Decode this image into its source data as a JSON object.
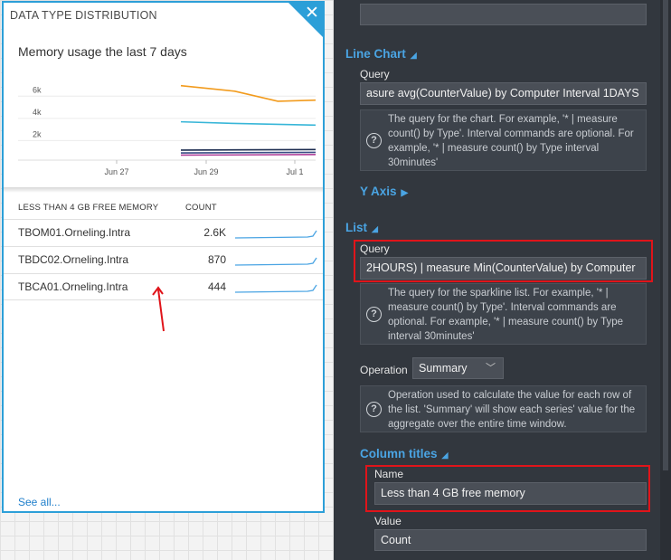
{
  "tile": {
    "title": "DATA TYPE DISTRIBUTION",
    "close_icon": "close-icon",
    "chart_title": "Memory usage the last 7 days",
    "list_header": {
      "name": "LESS THAN 4 GB FREE MEMORY",
      "count": "COUNT"
    },
    "rows": [
      {
        "name": "TBOM01.Orneling.Intra",
        "count": "2.6K"
      },
      {
        "name": "TBDC02.Orneling.Intra",
        "count": "870"
      },
      {
        "name": "TBCA01.Orneling.Intra",
        "count": "444"
      }
    ],
    "see_all": "See all...",
    "accent_color": "#2c9fd8"
  },
  "chart_data": {
    "type": "line",
    "x_ticks": [
      "Jun 27",
      "Jun 29",
      "Jul 1"
    ],
    "y_ticks": [
      "2k",
      "4k",
      "6k"
    ],
    "ylim": [
      0,
      7000
    ],
    "series": [
      {
        "color": "#f29b1d",
        "x": [
          0,
          0.4,
          0.72,
          1.0
        ],
        "values": [
          6700,
          6200,
          5300,
          5400
        ]
      },
      {
        "color": "#38b6d8",
        "x": [
          0,
          0.4,
          1.0
        ],
        "values": [
          3450,
          3300,
          3150
        ]
      },
      {
        "color": "#1b2b4f",
        "x": [
          0,
          1.0
        ],
        "values": [
          900,
          950
        ]
      },
      {
        "color": "#3b4f86",
        "x": [
          0,
          1.0
        ],
        "values": [
          650,
          700
        ]
      },
      {
        "color": "#b0419a",
        "x": [
          0,
          1.0
        ],
        "values": [
          450,
          500
        ]
      }
    ],
    "x_range": [
      -1.02,
      1.1
    ]
  },
  "panel": {
    "line_chart": {
      "section": "Line Chart",
      "query_label": "Query",
      "query_value": "asure avg(CounterValue) by Computer Interval 1DAYS",
      "help": "The query for the chart. For example, '* | measure count() by Type'. Interval commands are optional. For example, '* | measure count() by Type interval 30minutes'"
    },
    "y_axis": {
      "section": "Y Axis"
    },
    "list": {
      "section": "List",
      "query_label": "Query",
      "query_value": "2HOURS) | measure Min(CounterValue) by Computer",
      "help": "The query for the sparkline list. For example, '* | measure count() by Type'. Interval commands are optional. For example, '* | measure count() by Type interval 30minutes'",
      "operation_label": "Operation",
      "operation_value": "Summary",
      "operation_help": "Operation used to calculate the value for each row of the list. 'Summary' will show each series' value for the aggregate over the entire time window."
    },
    "column_titles": {
      "section": "Column titles",
      "name_label": "Name",
      "name_value": "Less than 4 GB free memory",
      "value_label": "Value",
      "value_value": "Count"
    },
    "highlight_color": "#e0141a",
    "section_color": "#4aa4e3"
  }
}
